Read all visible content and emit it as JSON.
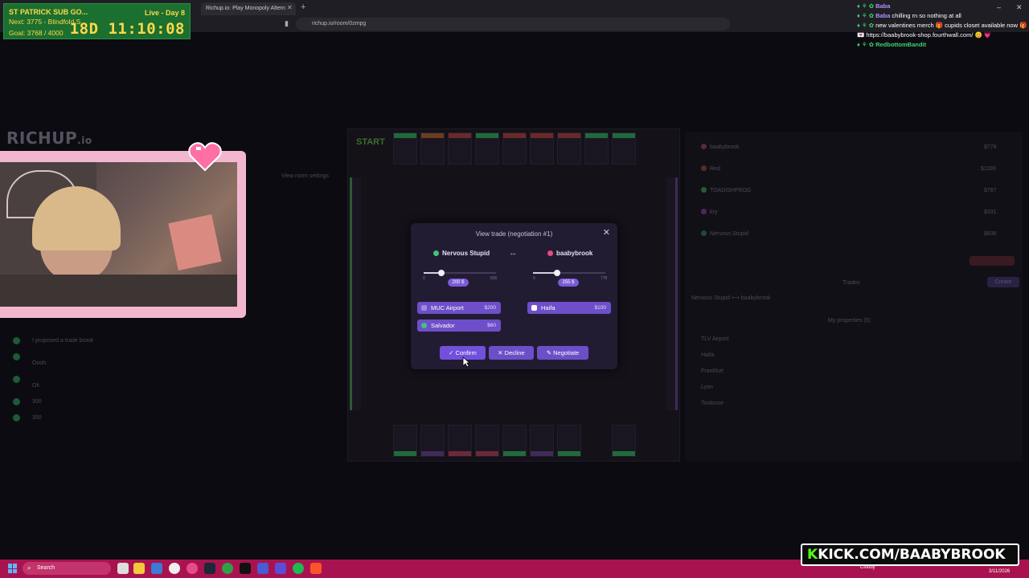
{
  "browser": {
    "tab_title": "Richup.io: Play Monopoly Altern",
    "url": "richup.io/room/0zmpg"
  },
  "timer": {
    "goal_name": "ST PATRICK SUB GO...",
    "next": "Next: 3775 - Blindfold S",
    "goal": "Goal: 3768 / 4000",
    "live_day": "Live - Day 8",
    "countdown": "18D  11:10:08"
  },
  "page": {
    "logo": "RICHUP",
    "logo_suffix": ".io",
    "view_room_settings": "View room settings",
    "chat_messages": [
      "I proposed a trade brook",
      "Oooh",
      "Ok",
      "300",
      "350"
    ]
  },
  "trade_modal": {
    "title": "View trade (negotiation #1)",
    "left_player": {
      "name": "Nervous Stupid",
      "dot_color": "#3fc47a",
      "slider_min": "0",
      "slider_max": "836",
      "slider_fraction": 0.24,
      "money": "200 $",
      "properties": [
        {
          "name": "MUC Airport",
          "price": "$200",
          "icon_color": "#9b8ad9"
        },
        {
          "name": "Salvador",
          "price": "$60",
          "icon_color": "#3fc47a"
        }
      ]
    },
    "right_player": {
      "name": "baabybrook",
      "dot_color": "#e84a7f",
      "slider_min": "0",
      "slider_max": "778",
      "slider_fraction": 0.33,
      "money": "255 $",
      "properties": [
        {
          "name": "Haifa",
          "price": "$100",
          "icon_color": "#ffffff"
        }
      ]
    },
    "buttons": {
      "confirm": "Confirm",
      "decline": "Decline",
      "negotiate": "Negotiate"
    }
  },
  "right_panel": {
    "players": [
      {
        "name": "baabybrook",
        "money": "$778"
      },
      {
        "name": "Red",
        "money": "$1189"
      },
      {
        "name": "TOADISHFROG",
        "money": "$787"
      },
      {
        "name": "kry",
        "money": "$331"
      },
      {
        "name": "Nervous Stupid",
        "money": "$836"
      }
    ],
    "trades_label": "Trades",
    "create_label": "Create",
    "trade_entry": "Nervous Stupid  ⟷  baabybrook",
    "my_properties": "My properties (5)",
    "properties": [
      "TLV Airport",
      "Haifa",
      "Frankfurt",
      "Lyon",
      "Toulouse"
    ]
  },
  "chat": [
    {
      "user": "Baba",
      "text": ""
    },
    {
      "user": "Baba",
      "text": "chilling rn so nothing at all"
    },
    {
      "user": "",
      "text": "new valentines merch 🎁 cupids closet available now 🎁 💌 https://baabybrook-shop.fourthwall.com/ 😊 💗"
    },
    {
      "user": "RedbottomBandit",
      "text": ""
    }
  ],
  "taskbar": {
    "search": "Search",
    "weather": "Cloudy",
    "date": "3/11/2026"
  },
  "kick_banner": {
    "prefix": "K",
    "text": "KICK.COM/BAABYBROOK"
  }
}
